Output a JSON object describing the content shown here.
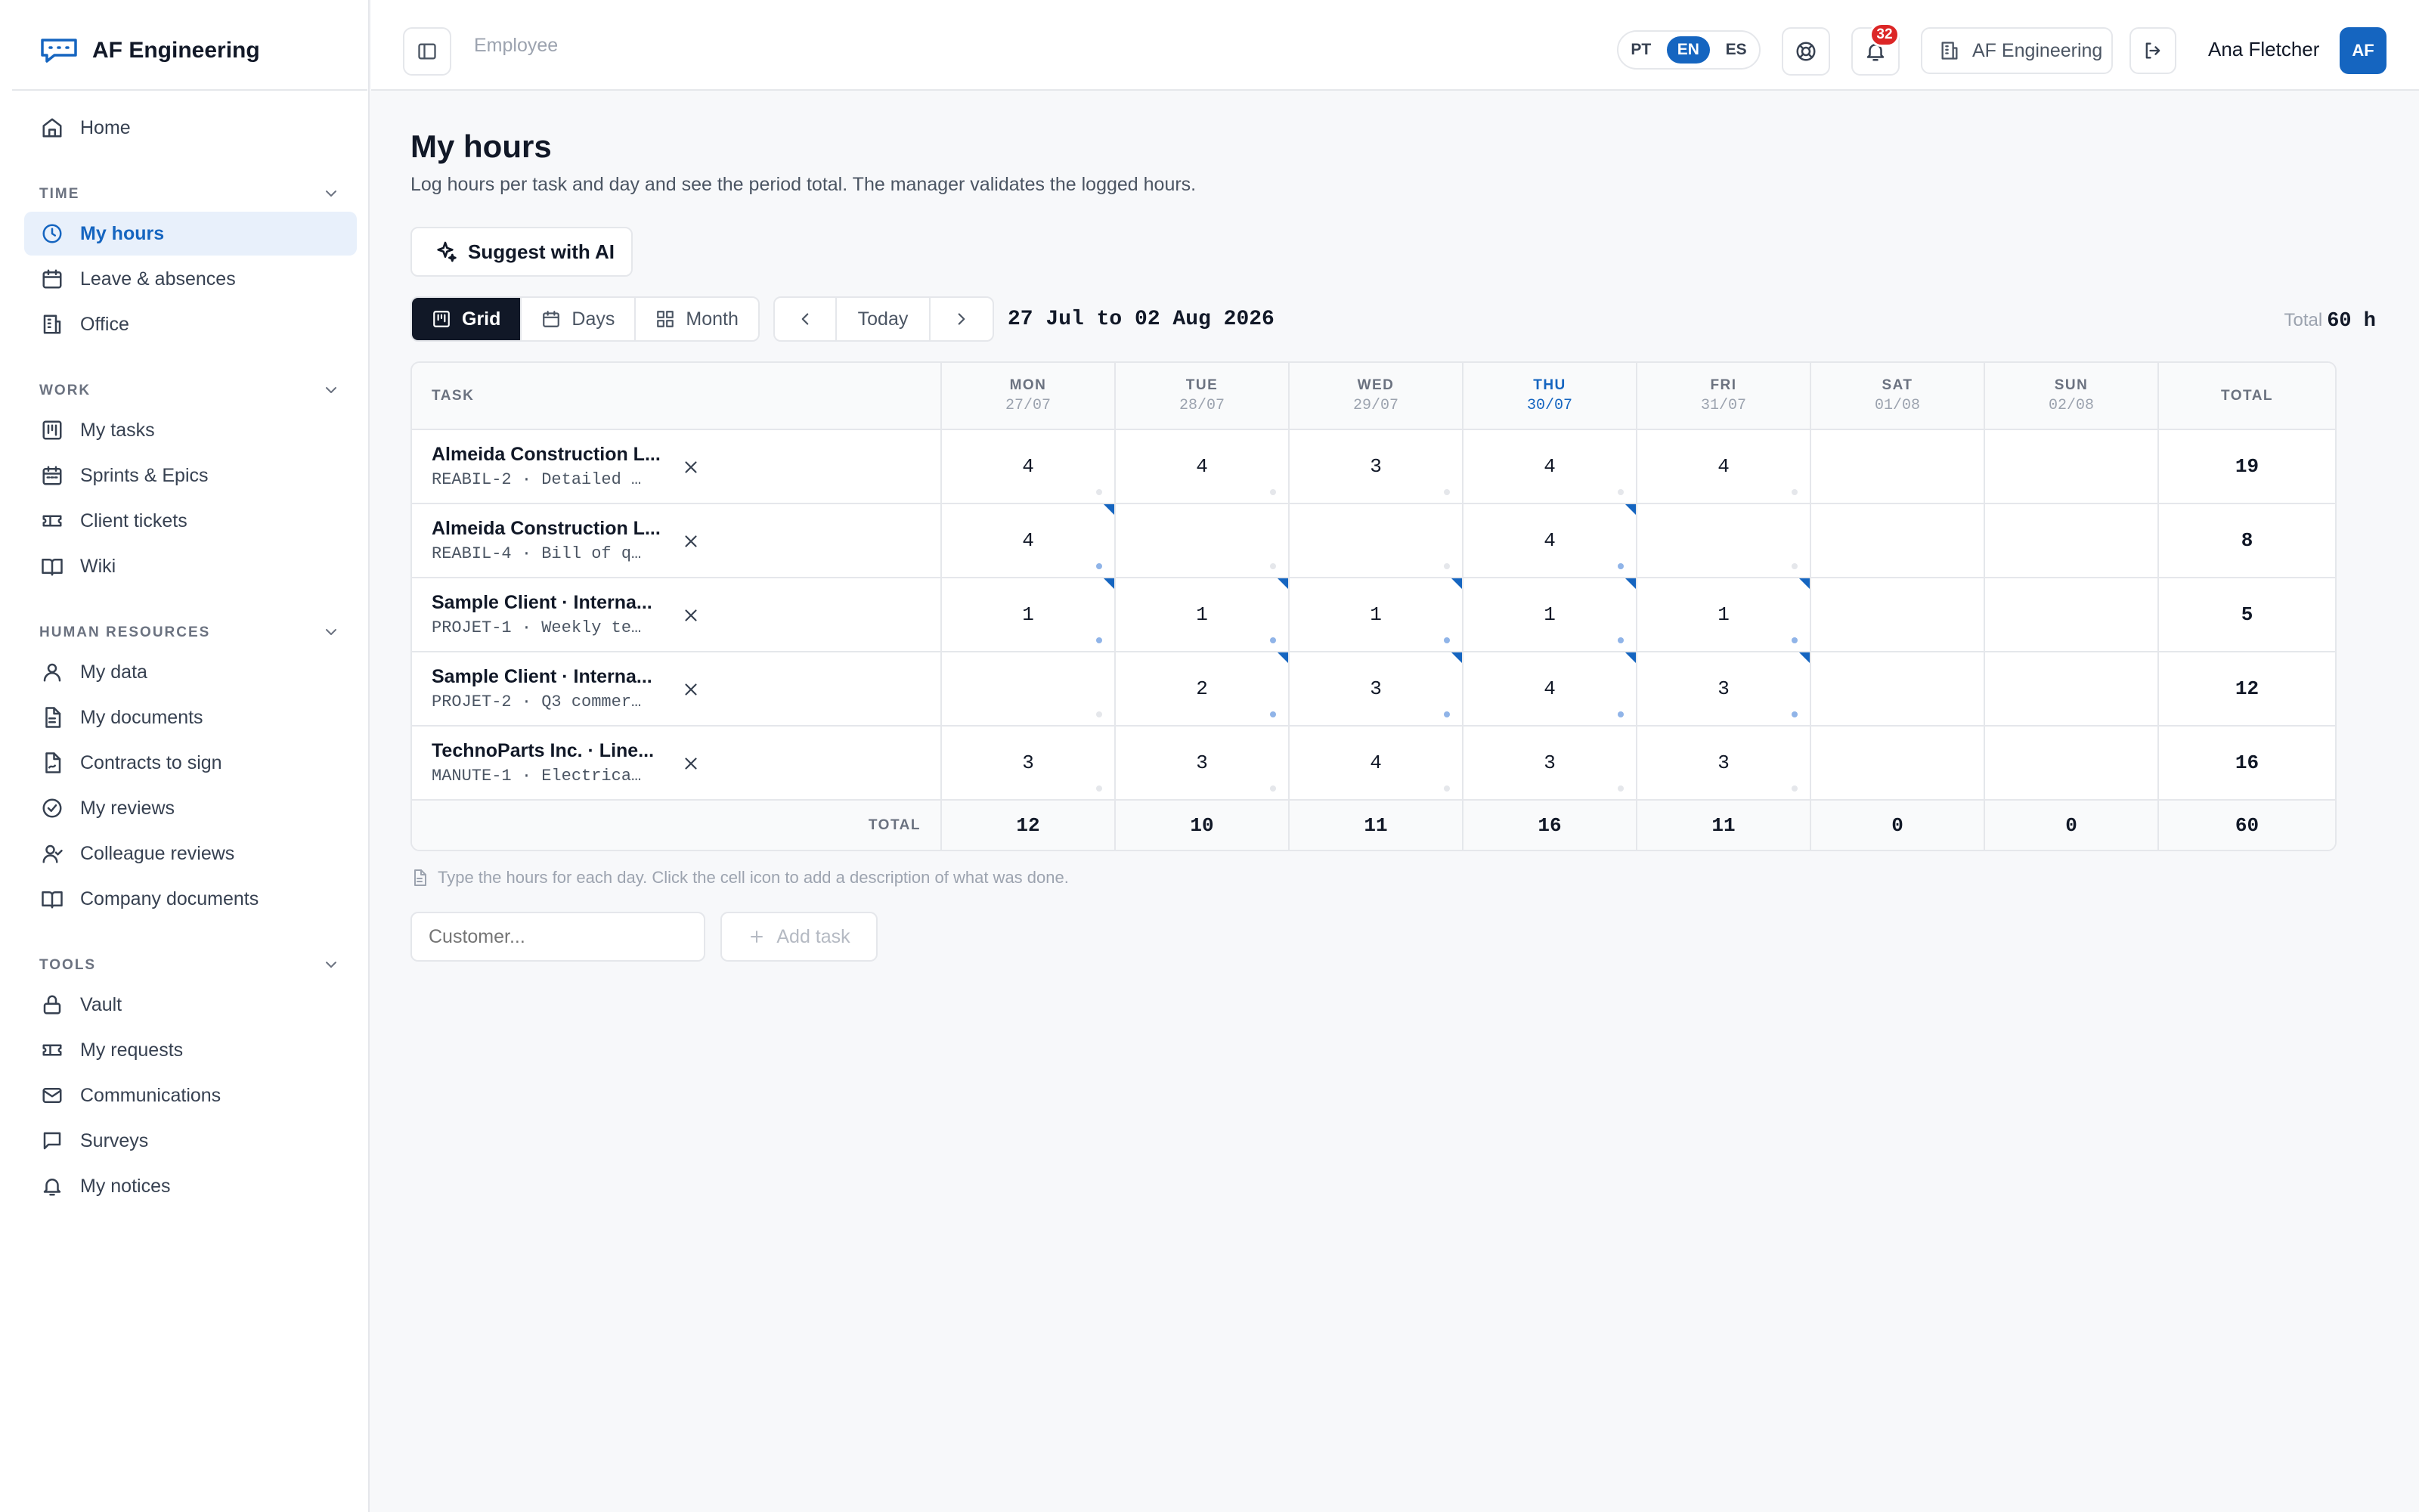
{
  "brand": {
    "name": "AF Engineering",
    "accent": "#1565c0"
  },
  "header": {
    "breadcrumb": "Employee",
    "languages": [
      "PT",
      "EN",
      "ES"
    ],
    "active_language": "EN",
    "notifications_count": "32",
    "company": "AF Engineering",
    "user_name": "Ana Fletcher",
    "user_initials": "AF"
  },
  "sidebar": {
    "home": "Home",
    "sections": [
      {
        "label": "TIME",
        "items": [
          "My hours",
          "Leave & absences",
          "Office"
        ]
      },
      {
        "label": "WORK",
        "items": [
          "My tasks",
          "Sprints & Epics",
          "Client tickets",
          "Wiki"
        ]
      },
      {
        "label": "HUMAN RESOURCES",
        "items": [
          "My data",
          "My documents",
          "Contracts to sign",
          "My reviews",
          "Colleague reviews",
          "Company documents"
        ]
      },
      {
        "label": "TOOLS",
        "items": [
          "Vault",
          "My requests",
          "Communications",
          "Surveys",
          "My notices"
        ]
      }
    ],
    "active_item": "My hours"
  },
  "page": {
    "title": "My hours",
    "subtitle": "Log hours per task and day and see the period total. The manager validates the logged hours.",
    "ai_button": "Suggest with AI",
    "views": [
      "Grid",
      "Days",
      "Month"
    ],
    "active_view": "Grid",
    "today_button": "Today",
    "range": "27 Jul to 02 Aug 2026",
    "total_label": "Total",
    "total_value": "60 h",
    "hint": "Type the hours for each day. Click the cell icon to add a description of what was done.",
    "customer_placeholder": "Customer...",
    "add_task": "Add task"
  },
  "grid": {
    "task_header": "TASK",
    "total_header": "TOTAL",
    "days": [
      {
        "name": "MON",
        "date": "27/07"
      },
      {
        "name": "TUE",
        "date": "28/07"
      },
      {
        "name": "WED",
        "date": "29/07"
      },
      {
        "name": "THU",
        "date": "30/07",
        "today": true
      },
      {
        "name": "FRI",
        "date": "31/07"
      },
      {
        "name": "SAT",
        "date": "01/08"
      },
      {
        "name": "SUN",
        "date": "02/08"
      }
    ],
    "rows": [
      {
        "title": "Almeida Construction L...",
        "code": "REABIL-2 · Detailed …",
        "hours": [
          "4",
          "4",
          "3",
          "4",
          "4",
          "",
          ""
        ],
        "total": "19",
        "noted": [
          false,
          false,
          false,
          false,
          false,
          false,
          false
        ]
      },
      {
        "title": "Almeida Construction L...",
        "code": "REABIL-4 · Bill of q…",
        "hours": [
          "4",
          "",
          "",
          "4",
          "",
          "",
          ""
        ],
        "total": "8",
        "noted": [
          true,
          false,
          false,
          true,
          false,
          false,
          false
        ]
      },
      {
        "title": "Sample Client · Interna...",
        "code": "PROJET-1 · Weekly te…",
        "hours": [
          "1",
          "1",
          "1",
          "1",
          "1",
          "",
          ""
        ],
        "total": "5",
        "noted": [
          true,
          true,
          true,
          true,
          true,
          false,
          false
        ]
      },
      {
        "title": "Sample Client · Interna...",
        "code": "PROJET-2 · Q3 commer…",
        "hours": [
          "",
          "2",
          "3",
          "4",
          "3",
          "",
          ""
        ],
        "total": "12",
        "noted": [
          false,
          true,
          true,
          true,
          true,
          false,
          false
        ]
      },
      {
        "title": "TechnoParts Inc. · Line...",
        "code": "MANUTE-1 · Electrica…",
        "hours": [
          "3",
          "3",
          "4",
          "3",
          "3",
          "",
          ""
        ],
        "total": "16",
        "noted": [
          false,
          false,
          false,
          false,
          false,
          false,
          false
        ]
      }
    ],
    "footer_label": "TOTAL",
    "day_totals": [
      "12",
      "10",
      "11",
      "16",
      "11",
      "0",
      "0"
    ],
    "grand_total": "60"
  }
}
